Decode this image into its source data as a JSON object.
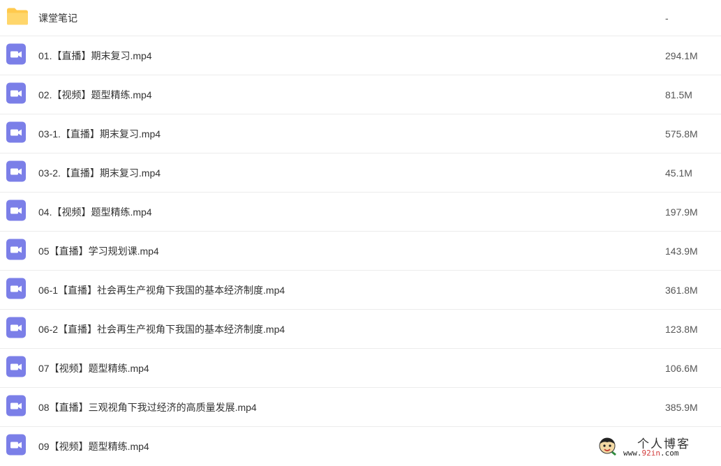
{
  "colors": {
    "folder": "#ffc94d",
    "video": "#7b7fe8",
    "divider": "#ececec"
  },
  "files": [
    {
      "icon": "folder-icon",
      "name": "课堂笔记",
      "size": "-"
    },
    {
      "icon": "video-file-icon",
      "name": "01.【直播】期末复习.mp4",
      "size": "294.1M"
    },
    {
      "icon": "video-file-icon",
      "name": "02.【视频】题型精练.mp4",
      "size": "81.5M"
    },
    {
      "icon": "video-file-icon",
      "name": "03-1.【直播】期末复习.mp4",
      "size": "575.8M"
    },
    {
      "icon": "video-file-icon",
      "name": "03-2.【直播】期末复习.mp4",
      "size": "45.1M"
    },
    {
      "icon": "video-file-icon",
      "name": "04.【视频】题型精练.mp4",
      "size": "197.9M"
    },
    {
      "icon": "video-file-icon",
      "name": "05【直播】学习规划课.mp4",
      "size": "143.9M"
    },
    {
      "icon": "video-file-icon",
      "name": "06-1【直播】社会再生产视角下我国的基本经济制度.mp4",
      "size": "361.8M"
    },
    {
      "icon": "video-file-icon",
      "name": "06-2【直播】社会再生产视角下我国的基本经济制度.mp4",
      "size": "123.8M"
    },
    {
      "icon": "video-file-icon",
      "name": "07【视频】题型精练.mp4",
      "size": "106.6M"
    },
    {
      "icon": "video-file-icon",
      "name": "08【直播】三观视角下我过经济的高质量发展.mp4",
      "size": "385.9M"
    },
    {
      "icon": "video-file-icon",
      "name": "09【视频】题型精练.mp4",
      "size": ""
    }
  ],
  "watermark": {
    "title": "个人博客",
    "url_prefix": "www.",
    "url_mid": "92in",
    "url_suffix": ".com"
  }
}
